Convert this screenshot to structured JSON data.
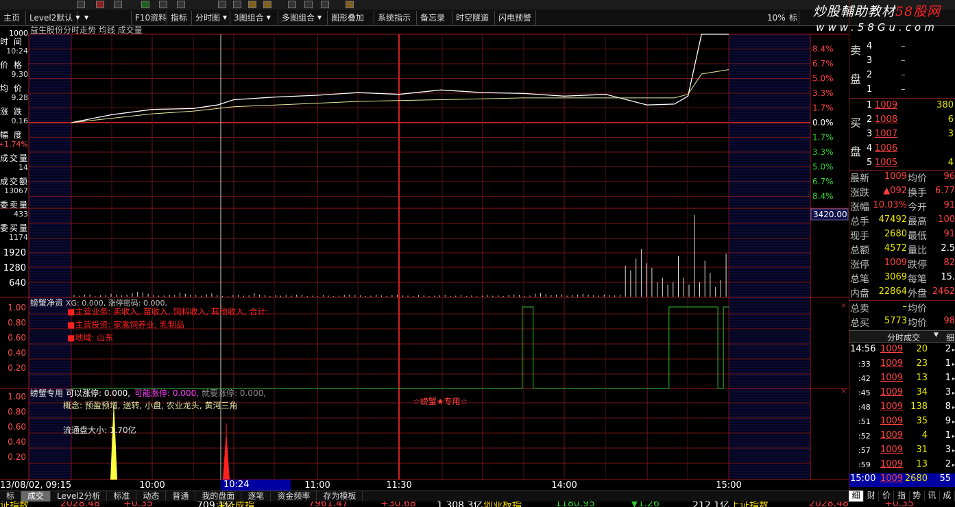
{
  "toolbar": {
    "items": [
      {
        "label": "主页",
        "drop": ""
      },
      {
        "label": "Level2默认",
        "drop": "▼"
      },
      {
        "label": "",
        "drop": "▼"
      },
      {
        "label": "F10资料",
        "drop": ""
      },
      {
        "label": "指标",
        "drop": ""
      },
      {
        "label": "分时图",
        "drop": "▼"
      },
      {
        "label": "3图组合",
        "drop": "▼"
      },
      {
        "label": "多图组合",
        "drop": "▼"
      },
      {
        "label": "图形叠加",
        "drop": ""
      },
      {
        "label": "系统指示",
        "drop": ""
      },
      {
        "label": "备忘录",
        "drop": ""
      },
      {
        "label": "时空隧道",
        "drop": ""
      },
      {
        "label": "闪电预警",
        "drop": ""
      }
    ],
    "zoom": "10%",
    "extra": "标"
  },
  "watermark": {
    "line1a": "炒股輔助教材",
    "line1b": "58股网",
    "line2": "www.58Gu.com"
  },
  "chart_title": "益生股份分时走势  均线  成交量",
  "left_panel": {
    "top_value": "1000",
    "fields": [
      {
        "label": "时  间",
        "value": "10:24"
      },
      {
        "label": "价  格",
        "value": "9.30"
      },
      {
        "label": "均  价",
        "value": "9.28"
      },
      {
        "label": "涨  跌",
        "value": "0.16"
      },
      {
        "label": "幅  度",
        "value": "+1.74%"
      },
      {
        "label": "成交量",
        "value": "14"
      },
      {
        "label": "成交额",
        "value": "13067"
      },
      {
        "label": "委卖量",
        "value": "433"
      },
      {
        "label": "委买量",
        "value": "1174"
      }
    ],
    "volume_ticks": [
      "1920",
      "1280",
      "640"
    ],
    "osc_ticks1": [
      "1.00",
      "0.80",
      "0.60",
      "0.40",
      "0.20"
    ],
    "osc_ticks2": [
      "1.00",
      "0.80",
      "0.60",
      "0.40",
      "0.20"
    ]
  },
  "percent_axis": {
    "upper": [
      "8.4%",
      "6.7%",
      "5.0%",
      "3.3%",
      "1.7%"
    ],
    "zero": "0.0%",
    "lower": [
      "1.7%",
      "3.3%",
      "5.0%",
      "6.7%",
      "8.4%"
    ]
  },
  "volume_readout": "3420.00",
  "time_axis": {
    "date": "13/08/02, 09:15",
    "selected": "10:24",
    "labels": [
      "10:00",
      "11:00",
      "11:30",
      "14:00",
      "15:00"
    ]
  },
  "panel1": {
    "header_name": "螃蟹净资",
    "header_rest": "XG: 0.000, 涨停密码: 0.000,",
    "lines": [
      "■主营业务: 卖收入, 苗收入, 饲料收入, 其他收入, 合计:",
      "■主营投资: 家禽饲养业, 乳制品",
      "■地域: 山东"
    ]
  },
  "panel2": {
    "header_name": "螃蟹专用",
    "a_label": "可以涨停: 0.000,",
    "b_label": "可能涨停: 0.000,",
    "c_label": "就要涨停: 0.000,",
    "concept": "概念: 预盈预增, 送转, 小盘, 农业龙头, 黄河三角",
    "float_size": "流通盘大小: 1.70亿",
    "banner": "☆螃蟹★专用☆"
  },
  "right_panel": {
    "sell": {
      "side_top": "卖",
      "side_bottom": "盘",
      "rows": [
        {
          "n": "4",
          "p": "–",
          "v": ""
        },
        {
          "n": "3",
          "p": "–",
          "v": ""
        },
        {
          "n": "2",
          "p": "–",
          "v": ""
        },
        {
          "n": "1",
          "p": "–",
          "v": ""
        }
      ]
    },
    "buy": {
      "side_top": "买",
      "side_bottom": "盘",
      "rows": [
        {
          "n": "1",
          "p": "1009",
          "v": "380"
        },
        {
          "n": "2",
          "p": "1008",
          "v": "6"
        },
        {
          "n": "3",
          "p": "1007",
          "v": "3"
        },
        {
          "n": "4",
          "p": "1006",
          "v": ""
        },
        {
          "n": "5",
          "p": "1005",
          "v": "4"
        }
      ]
    },
    "stats": [
      {
        "l1": "最新",
        "v1": "1009",
        "l2": "均价",
        "v2": "96"
      },
      {
        "l1": "涨跌",
        "v1": "▲092",
        "l2": "换手",
        "v2": "6.77"
      },
      {
        "l1": "涨幅",
        "v1": "10.03%",
        "l2": "今开",
        "v2": "91"
      },
      {
        "l1": "总手",
        "v1": "47492",
        "l2": "最高",
        "v2": "100"
      },
      {
        "l1": "现手",
        "v1": "2680",
        "l2": "最低",
        "v2": "91"
      },
      {
        "l1": "总额",
        "v1": "4572",
        "l2": "量比",
        "v2": "2.5"
      },
      {
        "l1": "涨停",
        "v1": "1009",
        "l2": "跌停",
        "v2": "82"
      },
      {
        "l1": "总笔",
        "v1": "3069",
        "l2": "每笔",
        "v2": "15."
      },
      {
        "l1": "内盘",
        "v1": "22864",
        "l2": "外盘",
        "v2": "2462"
      }
    ],
    "totals": [
      {
        "l1": "总卖",
        "v1": "–",
        "l2": "均价",
        "v2": ""
      },
      {
        "l1": "总买",
        "v1": "5773",
        "l2": "均价",
        "v2": "98"
      }
    ],
    "ticks_header": "分时成交",
    "ticks_tab": "细",
    "ticks": [
      {
        "t": "14:56",
        "p": "1009",
        "v": "20",
        "n": "2"
      },
      {
        "t": ":33",
        "p": "1009",
        "v": "23",
        "n": "1"
      },
      {
        "t": ":42",
        "p": "1009",
        "v": "13",
        "n": "1"
      },
      {
        "t": ":45",
        "p": "1009",
        "v": "34",
        "n": "3"
      },
      {
        "t": ":48",
        "p": "1009",
        "v": "138",
        "n": "8"
      },
      {
        "t": ":51",
        "p": "1009",
        "v": "35",
        "n": "9"
      },
      {
        "t": ":52",
        "p": "1009",
        "v": "4",
        "n": "1"
      },
      {
        "t": ":57",
        "p": "1009",
        "v": "31",
        "n": "3"
      },
      {
        "t": ":59",
        "p": "1009",
        "v": "13",
        "n": "2"
      },
      {
        "t": "15:00",
        "p": "1009",
        "v": "2680",
        "n": "55"
      }
    ]
  },
  "bottom_tabs": [
    "标",
    "成交",
    "Level2分析",
    "标准",
    "动态",
    "普通",
    "我的盘面",
    "逐笔",
    "资金频率",
    "存为模板"
  ],
  "right_tabs": [
    "细",
    "财",
    "价",
    "指",
    "势",
    "讯",
    "成"
  ],
  "ticker": [
    {
      "text": "证指数",
      "color": "#ffdd00"
    },
    {
      "text": "2028.48",
      "color": "#ff4040"
    },
    {
      "text": "+0.35",
      "color": "#ff4040"
    },
    {
      "text": "709.1亿",
      "color": "#fff"
    },
    {
      "text": "深证成指",
      "color": "#ffdd00"
    },
    {
      "text": "7961.47",
      "color": "#ff4040"
    },
    {
      "text": "+30.68",
      "color": "#ff4040"
    },
    {
      "text": "1,308.3亿",
      "color": "#fff"
    },
    {
      "text": "创业板指",
      "color": "#ffdd00"
    },
    {
      "text": "1180.95",
      "color": "#30d030"
    },
    {
      "text": "▼1.26",
      "color": "#30d030"
    },
    {
      "text": "212.1亿",
      "color": "#fff"
    },
    {
      "text": "上证指数",
      "color": "#ffdd00"
    },
    {
      "text": "2028.48",
      "color": "#ff4040"
    },
    {
      "text": "+0.35",
      "color": "#ff4040"
    }
  ],
  "chart_data": {
    "type": "line",
    "x": [
      "09:30",
      "09:45",
      "10:00",
      "10:15",
      "10:24",
      "10:30",
      "10:45",
      "11:00",
      "11:15",
      "11:30",
      "13:15",
      "13:30",
      "13:45",
      "14:00",
      "14:15",
      "14:30",
      "14:40",
      "14:45",
      "14:50",
      "15:00"
    ],
    "series": [
      {
        "values": [
          0.0,
          0.9,
          1.5,
          1.6,
          2.0,
          2.6,
          2.9,
          3.1,
          3.4,
          3.2,
          3.7,
          3.4,
          3.3,
          3.0,
          3.2,
          2.0,
          2.1,
          3.0,
          10.0,
          10.0
        ]
      },
      {
        "values": [
          0.0,
          0.5,
          1.0,
          1.3,
          1.6,
          1.8,
          2.0,
          2.2,
          2.4,
          2.5,
          2.6,
          2.7,
          2.8,
          2.8,
          2.8,
          2.8,
          2.8,
          3.2,
          5.5,
          6.0
        ]
      }
    ],
    "ylim": [
      -10,
      10
    ],
    "yunits": "percent",
    "volume": {
      "ylim": [
        0,
        3420
      ],
      "ticks": [
        640,
        1280,
        1920
      ],
      "bars": [
        60,
        40,
        80,
        90,
        30,
        50,
        60,
        120,
        70,
        50,
        80,
        150,
        200,
        180,
        120,
        60,
        40,
        50,
        80,
        70,
        160,
        120,
        90,
        60,
        40,
        90,
        130,
        60,
        30,
        20,
        60,
        70,
        40,
        50,
        150,
        90,
        60,
        30,
        60,
        40,
        60,
        40,
        80,
        70,
        30,
        40,
        20,
        60,
        40,
        30,
        40,
        70,
        90,
        60,
        50,
        30,
        40,
        90,
        50,
        30,
        60,
        80,
        50,
        40,
        30,
        60,
        50,
        30,
        40,
        50,
        70,
        30,
        40,
        60,
        30,
        50,
        20,
        40,
        60,
        40,
        50,
        30,
        60,
        90,
        60,
        30,
        40,
        120,
        150,
        100,
        60,
        80,
        90,
        40,
        70,
        90,
        120,
        80,
        60,
        40,
        90,
        70,
        50,
        80,
        1300,
        1100,
        1600,
        2000,
        1400,
        1200,
        600,
        800,
        500,
        600,
        1700,
        800,
        500,
        3420,
        600,
        1500,
        1000,
        400,
        700,
        1800
      ]
    },
    "osc1": {
      "ylim": [
        0,
        1
      ],
      "values": [
        0,
        0,
        0,
        0,
        0,
        0,
        0,
        0,
        0,
        0,
        0,
        0,
        0,
        0,
        0,
        0,
        0,
        0,
        0,
        0,
        0,
        0,
        0,
        0,
        0,
        0,
        0,
        0,
        0,
        0,
        0,
        0,
        0,
        0,
        0,
        0,
        0,
        0,
        0,
        0,
        0,
        0,
        0,
        0,
        0,
        0,
        0,
        0,
        0,
        0,
        0,
        0,
        0,
        0,
        0,
        0,
        0,
        0,
        0,
        0,
        0,
        0,
        0,
        0,
        0,
        0,
        0,
        0,
        0,
        0,
        0,
        0,
        0,
        0,
        0,
        0,
        0,
        0,
        0,
        0,
        0,
        0,
        0,
        1,
        1,
        0,
        0,
        0,
        0,
        0,
        0,
        0,
        0,
        0,
        0,
        0,
        0,
        0,
        0,
        0,
        0,
        0,
        0,
        0,
        0,
        0,
        0,
        0,
        0,
        0,
        1,
        1,
        1,
        1,
        1,
        1,
        1,
        1,
        1,
        0,
        1
      ]
    },
    "osc2": {
      "ylim": [
        0,
        1
      ],
      "yellow_index": 13,
      "red_index": 34
    }
  }
}
